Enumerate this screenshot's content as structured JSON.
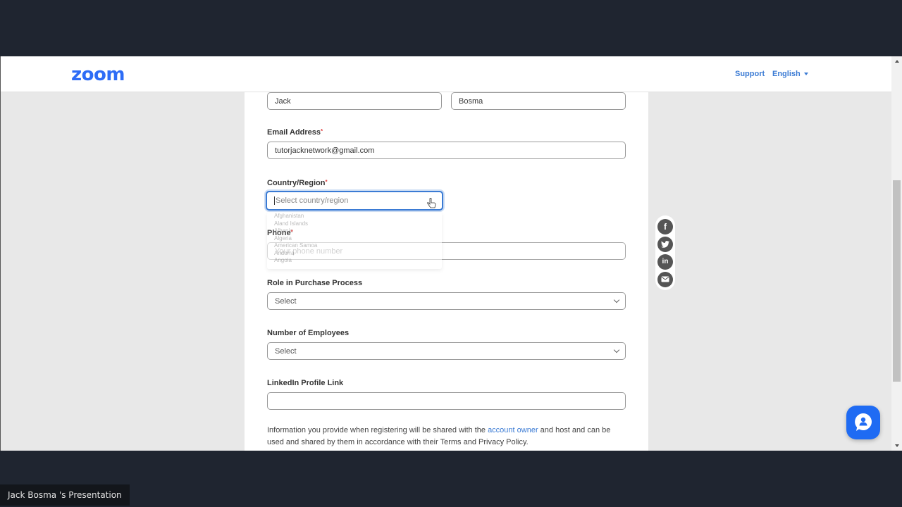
{
  "header": {
    "logo": "zoom",
    "support_label": "Support",
    "language_label": "English"
  },
  "form": {
    "first_name_value": "Jack",
    "last_name_value": "Bosma",
    "email": {
      "label": "Email Address",
      "required_mark": "*",
      "value": "tutorjacknetwork@gmail.com"
    },
    "country": {
      "label": "Country/Region",
      "required_mark": "*",
      "placeholder": "Select country/region",
      "options": [
        "Afghanistan",
        "Aland Islands",
        "Albania",
        "Algeria",
        "American Samoa",
        "Andorra",
        "Angola"
      ]
    },
    "phone": {
      "label": "Phone",
      "required_mark": "*",
      "placeholder": "Your phone number"
    },
    "role": {
      "label": "Role in Purchase Process",
      "value": "Select"
    },
    "employees": {
      "label": "Number of Employees",
      "value": "Select"
    },
    "linkedin": {
      "label": "LinkedIn Profile Link",
      "value": ""
    },
    "notice": {
      "before": "Information you provide when registering will be shared with the ",
      "link": "account owner",
      "after": " and host and can be used and shared by them in accordance with their Terms and Privacy Policy."
    }
  },
  "social": [
    "facebook",
    "twitter",
    "linkedin",
    "email"
  ],
  "chat": {
    "icon": "chat-support-icon"
  },
  "presenter": {
    "label": "Jack Bosma 's Presentation"
  },
  "colors": {
    "brand": "#2d6cf6",
    "link": "#3b7bd4",
    "chat": "#1f6bf3"
  }
}
